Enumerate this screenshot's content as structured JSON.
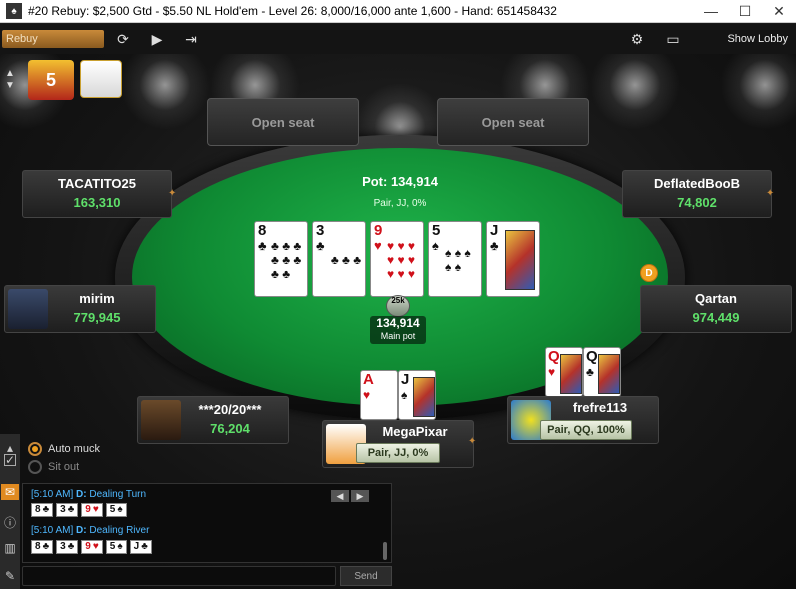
{
  "window": {
    "app_icon": "pokerstars-app-icon",
    "title": "#20 Rebuy: $2,500 Gtd - $5.50 NL Hold'em - Level 26: 8,000/16,000 ante 1,600 - Hand: 651458432",
    "minimize": "—",
    "maximize": "☐",
    "close": "✕"
  },
  "toolbar": {
    "rebuy_label": "Rebuy",
    "refresh_icon": "refresh-icon",
    "play_icon": "play-icon",
    "exit_icon": "exit-icon",
    "settings_icon": "gear-icon",
    "layout_icon": "window-layout-icon",
    "show_lobby": "Show Lobby"
  },
  "table": {
    "open_seats": [
      "Open seat",
      "Open seat"
    ],
    "pot_label": "Pot: 134,914",
    "hand_description": "Pair, JJ, 0%",
    "main_pot_value": "134,914",
    "main_pot_label": "Main pot",
    "chip_label": "25k",
    "dealer_button": "D",
    "board": [
      {
        "rank": "8",
        "suit": "♣",
        "color": "#111111"
      },
      {
        "rank": "3",
        "suit": "♣",
        "color": "#111111"
      },
      {
        "rank": "9",
        "suit": "♥",
        "color": "#d0101a"
      },
      {
        "rank": "5",
        "suit": "♠",
        "color": "#111111"
      },
      {
        "rank": "J",
        "suit": "♣",
        "color": "#111111"
      }
    ]
  },
  "players": [
    {
      "name": "TACATITO25",
      "stack": "163,310"
    },
    {
      "name": "DeflatedBooB",
      "stack": "74,802"
    },
    {
      "name": "mirim",
      "stack": "779,945"
    },
    {
      "name": "Qartan",
      "stack": "974,449"
    },
    {
      "name": "***20/20***",
      "stack": "76,204"
    },
    {
      "name": "MegaPixar",
      "hand": "Pair, JJ, 0%",
      "cards": [
        {
          "rank": "A",
          "suit": "♥"
        },
        {
          "rank": "J",
          "suit": "♠"
        }
      ]
    },
    {
      "name": "frefre113",
      "hand": "Pair, QQ, 100%",
      "cards": [
        {
          "rank": "Q",
          "suit": "♥"
        },
        {
          "rank": "Q",
          "suit": "♣"
        }
      ]
    }
  ],
  "options": {
    "auto_muck": "Auto muck",
    "sit_out": "Sit out"
  },
  "chat": {
    "line1_time": "[5:10 AM]",
    "line1_dealer": "D:",
    "line1_text": "Dealing Turn",
    "turn_cards": [
      {
        "rank": "8",
        "suit": "♣",
        "color": "#111111"
      },
      {
        "rank": "3",
        "suit": "♣",
        "color": "#111111"
      },
      {
        "rank": "9",
        "suit": "♥",
        "color": "#d0101a"
      },
      {
        "rank": "5",
        "suit": "♠",
        "color": "#111111"
      }
    ],
    "line2_time": "[5:10 AM]",
    "line2_dealer": "D:",
    "line2_text": "Dealing River",
    "river_cards": [
      {
        "rank": "8",
        "suit": "♣",
        "color": "#111111"
      },
      {
        "rank": "3",
        "suit": "♣",
        "color": "#111111"
      },
      {
        "rank": "9",
        "suit": "♥",
        "color": "#d0101a"
      },
      {
        "rank": "5",
        "suit": "♠",
        "color": "#111111"
      },
      {
        "rank": "J",
        "suit": "♣",
        "color": "#111111"
      }
    ],
    "send_label": "Send",
    "nav_prev": "◀",
    "nav_next": "▶"
  },
  "colors": {
    "felt": "#0f8a33",
    "stack_green": "#5fe06a",
    "accent_orange": "#f0a020",
    "chat_blue": "#4fb8ff"
  }
}
